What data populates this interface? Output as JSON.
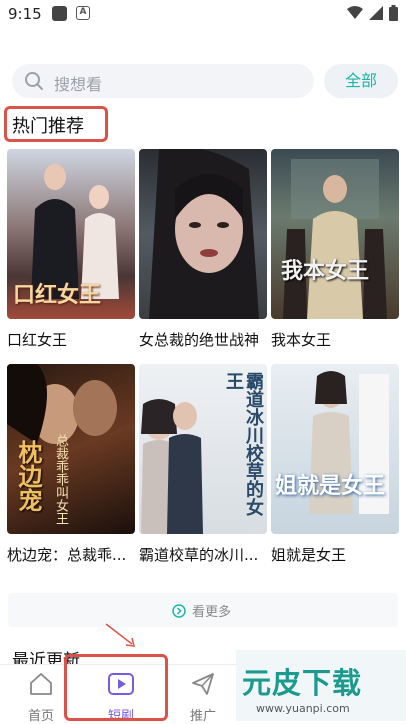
{
  "status_bar": {
    "time": "9:15"
  },
  "search": {
    "placeholder": "搜想看",
    "all_button": "全部"
  },
  "hot_section": {
    "title": "热门推荐"
  },
  "dramas": [
    {
      "title": "口红女王",
      "poster_text": "口红女王"
    },
    {
      "title": "女总裁的绝世战神",
      "poster_text": ""
    },
    {
      "title": "我本女王",
      "poster_text": "我本女王"
    },
    {
      "title": "枕边宠：总裁乖...",
      "poster_text": "枕边宠",
      "poster_sub": "总裁乖乖叫女王"
    },
    {
      "title": "霸道校草的冰川...",
      "poster_text": "霸道冰川校草的女王"
    },
    {
      "title": "姐就是女王",
      "poster_text": "姐就是女王"
    }
  ],
  "more": {
    "label": "看更多"
  },
  "recent_section": {
    "title": "最近更新"
  },
  "tabs": [
    {
      "label": "首页",
      "icon": "home-icon"
    },
    {
      "label": "短剧",
      "icon": "play-icon"
    },
    {
      "label": "推广",
      "icon": "send-icon"
    }
  ],
  "watermark": {
    "brand": "元皮下载",
    "url": "www.yuanpi.com"
  },
  "colors": {
    "accent": "#1db6a8",
    "active_tab": "#7a5be0",
    "highlight": "#d9534a"
  }
}
